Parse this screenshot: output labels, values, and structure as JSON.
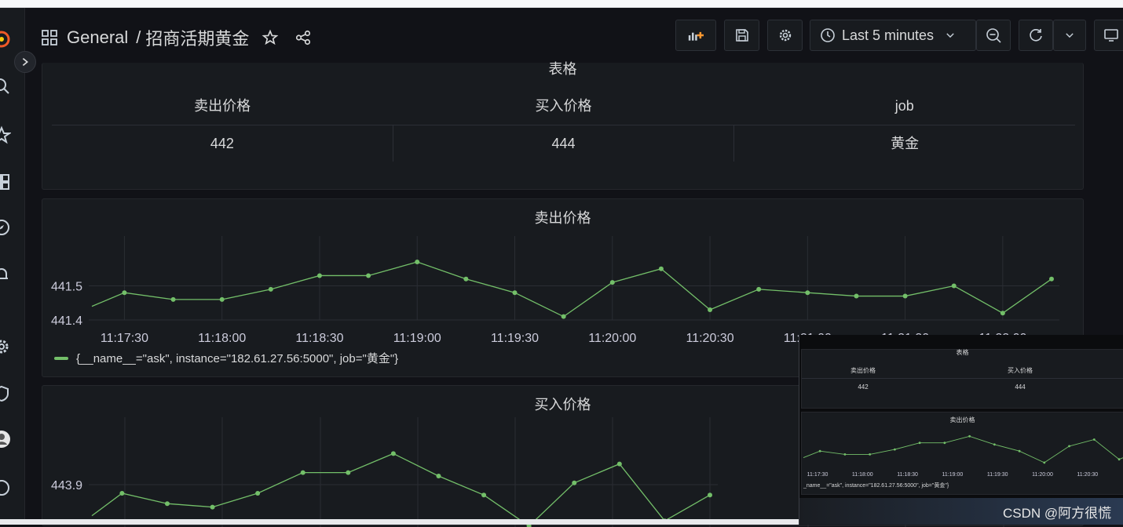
{
  "navbar": {
    "section": "General",
    "separator": "/",
    "dashboard_title": "招商活期黄金",
    "time_range": "Last 5 minutes"
  },
  "table_panel": {
    "title": "表格",
    "columns": [
      "卖出价格",
      "买入价格",
      "job"
    ],
    "rows": [
      [
        "442",
        "444",
        "黄金"
      ]
    ]
  },
  "sell_panel": {
    "title": "卖出价格",
    "legend": "{__name__=\"ask\", instance=\"182.61.27.56:5000\", job=\"黄金\"}"
  },
  "buy_panel": {
    "title": "买入价格"
  },
  "inset": {
    "table_title": "表格",
    "col1": "卖出价格",
    "col2": "买入价格",
    "val1": "442",
    "val2": "444",
    "chart_title": "卖出价格",
    "ticks": [
      "11:17:30",
      "11:18:00",
      "11:18:30",
      "11:19:00",
      "11:19:30",
      "11:20:00",
      "11:20:30",
      "1"
    ],
    "legend": "_name__=\"ask\", instance=\"182.61.27.56:5000\", job=\"黄金\"}"
  },
  "watermark": "CSDN @阿方很慌",
  "colors": {
    "series": "#73bf69",
    "panel": "#181b1f",
    "bg": "#111217"
  },
  "chart_data": [
    {
      "type": "line",
      "title": "卖出价格",
      "x": [
        "11:17:20",
        "11:17:30",
        "11:17:45",
        "11:18:00",
        "11:18:15",
        "11:18:30",
        "11:18:45",
        "11:19:00",
        "11:19:15",
        "11:19:30",
        "11:19:45",
        "11:20:00",
        "11:20:15",
        "11:20:30",
        "11:20:45",
        "11:21:00",
        "11:21:15",
        "11:21:30",
        "11:21:45",
        "11:22:00",
        "11:22:15"
      ],
      "x_ticks": [
        "11:17:30",
        "11:18:00",
        "11:18:30",
        "11:19:00",
        "11:19:30",
        "11:20:00",
        "11:20:30",
        "11:21:00",
        "11:21:30",
        "11:22:00"
      ],
      "y_ticks": [
        441.4,
        441.5
      ],
      "ylim": [
        441.4,
        441.6
      ],
      "series": [
        {
          "name": "{__name__=\"ask\", instance=\"182.61.27.56:5000\", job=\"黄金\"}",
          "values": [
            441.44,
            441.48,
            441.46,
            441.46,
            441.49,
            441.53,
            441.53,
            441.57,
            441.52,
            441.48,
            441.41,
            441.51,
            441.55,
            441.43,
            441.49,
            441.48,
            441.47,
            441.47,
            441.5,
            441.42,
            441.52
          ]
        }
      ]
    },
    {
      "type": "line",
      "title": "买入价格",
      "x": [
        "11:17:20",
        "11:17:30",
        "11:17:45",
        "11:18:00",
        "11:18:15",
        "11:18:30",
        "11:18:45",
        "11:19:00",
        "11:19:15",
        "11:19:30",
        "11:19:45",
        "11:20:00",
        "11:20:15",
        "11:20:30",
        "11:20:45"
      ],
      "y_ticks": [
        443.9
      ],
      "ylim": [
        443.7,
        444.2
      ],
      "series": [
        {
          "values": [
            443.72,
            443.85,
            443.79,
            443.77,
            443.85,
            443.97,
            443.97,
            444.08,
            443.95,
            443.84,
            443.66,
            443.91,
            444.02,
            443.69,
            443.84
          ]
        }
      ]
    }
  ]
}
